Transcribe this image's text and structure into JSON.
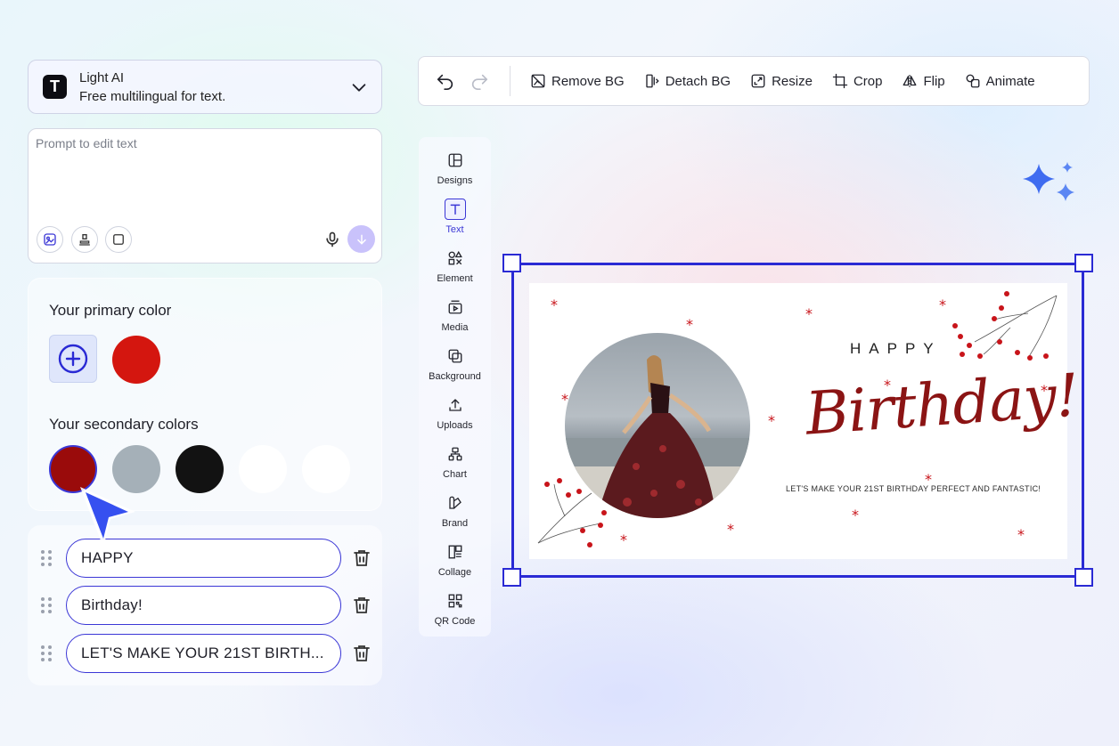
{
  "model": {
    "name": "Light AI",
    "description": "Free multilingual for text.",
    "logo_letter": "T"
  },
  "prompt": {
    "placeholder": "Prompt to edit text"
  },
  "colors": {
    "primary_title": "Your primary color",
    "primary": [
      "#d4160f"
    ],
    "secondary_title": "Your secondary colors",
    "secondary": [
      "#9a0b0b",
      "#a5b0b8",
      "#121212",
      "#ffffff",
      "#ffffff"
    ]
  },
  "text_items": [
    {
      "value": "HAPPY"
    },
    {
      "value": "Birthday!"
    },
    {
      "value": "LET'S MAKE YOUR 21ST BIRTH..."
    }
  ],
  "toolbar": {
    "remove_bg": "Remove BG",
    "detach_bg": "Detach BG",
    "resize": "Resize",
    "crop": "Crop",
    "flip": "Flip",
    "animate": "Animate"
  },
  "nav": [
    {
      "label": "Designs"
    },
    {
      "label": "Text"
    },
    {
      "label": "Element"
    },
    {
      "label": "Media"
    },
    {
      "label": "Background"
    },
    {
      "label": "Uploads"
    },
    {
      "label": "Chart"
    },
    {
      "label": "Brand"
    },
    {
      "label": "Collage"
    },
    {
      "label": "QR Code"
    }
  ],
  "card": {
    "happy": "HAPPY",
    "birthday": "Birthday!",
    "tagline": "LET'S MAKE YOUR 21ST BIRTHDAY PERFECT AND FANTASTIC!"
  },
  "accent_color": "#3b37d6"
}
